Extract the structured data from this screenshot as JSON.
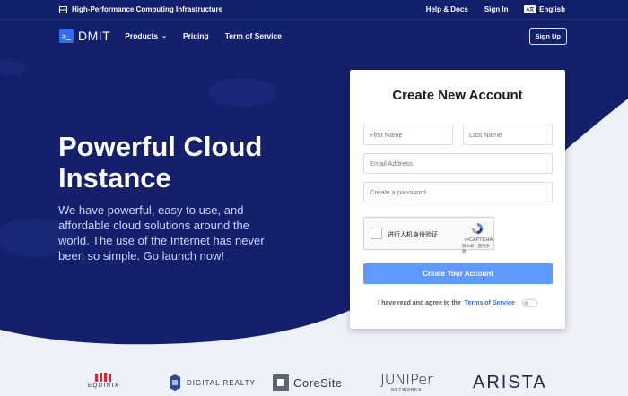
{
  "topbar": {
    "infra_label": "High-Performance Computing Infrastructure",
    "help_label": "Help & Docs",
    "signin_label": "Sign In",
    "lang_badge": "A文",
    "lang_label": "English"
  },
  "nav": {
    "brand": "DMIT",
    "products_label": "Products",
    "pricing_label": "Pricing",
    "tos_label": "Term of Service",
    "signup_label": "Sign Up"
  },
  "hero": {
    "title_line1": "Powerful Cloud",
    "title_line2": "Instance",
    "description": "We have powerful, easy to use, and affordable cloud solutions around the world. The use of the Internet has never been so simple. Go launch now!"
  },
  "form": {
    "title": "Create New Account",
    "first_name_placeholder": "First Name",
    "last_name_placeholder": "Last Name",
    "email_placeholder": "Email Address",
    "password_placeholder": "Create a password",
    "captcha_label": "进行人机身份验证",
    "captcha_brand": "reCAPTCHA",
    "captcha_links": "隐私权 - 使用条款",
    "submit_label": "Create Your Account",
    "agree_prefix": "I have read and agree to the",
    "agree_link": "Terms of Service",
    "agree_toggle_on": false
  },
  "partners": {
    "equinix": "EQUINIX",
    "digital_realty": "DIGITAL REALTY",
    "coresite": "CoreSite",
    "juniper": "JUNIPer",
    "juniper_sub": "NETWORKS",
    "arista": "ARISTA"
  },
  "colors": {
    "hero_bg": "#14206b",
    "accent": "#2f6ff0",
    "submit_bg": "#5e9aff",
    "lower_bg": "#eef0f6"
  }
}
